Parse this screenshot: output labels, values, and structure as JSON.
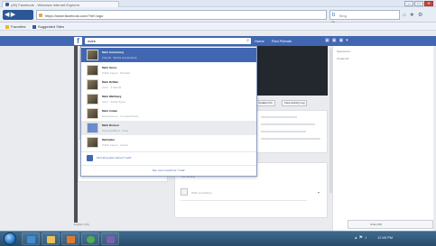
{
  "browser": {
    "tab_title": "(45) Facebook - Windows Internet Explorer",
    "url": "https://www.facebook.com/?ref=logo",
    "search_placeholder": "Bing",
    "window_controls": [
      "–",
      "□",
      "✕"
    ],
    "favorites": {
      "favorites_label": "Favorites",
      "suggested_label": "Suggested Sites"
    }
  },
  "facebook": {
    "search_value": "mark",
    "nav": [
      "Home",
      "Find Friends"
    ],
    "cover_buttons": [
      "Update Info",
      "View Activity Log"
    ],
    "dropdown": {
      "suggestions": [
        {
          "name": "Mark Zuckerberg",
          "meta": "Friends · Works at Facebook"
        },
        {
          "name": "Mark Henry",
          "meta": "Public Figure · Wrestler"
        },
        {
          "name": "Mark Ruffalo",
          "meta": "Actor · 2 friends"
        },
        {
          "name": "Mark Wahlberg",
          "meta": "Actor · Public figure"
        },
        {
          "name": "Mark Cuban",
          "meta": "Entrepreneur · 1 mutual friend"
        },
        {
          "name": "Mark Ronson",
          "meta": "Musician/Band · Page"
        },
        {
          "name": "Markiplier",
          "meta": "Public Figure · Gamer"
        }
      ],
      "find_label": "Find all people named \"mark\"",
      "more_label": "See more results for \"mark\""
    },
    "status": {
      "title": "Update Status",
      "subtitle": "What's on your mind?",
      "privacy": "Public",
      "cancel": "Cancel",
      "post": "Post"
    },
    "post": {
      "title": "Recent Activity",
      "subtitle": "Your activity",
      "input_placeholder": "Write something..."
    },
    "right_panel": [
      "Sponsored",
      "Create Ad"
    ],
    "chat_label": "Chat (Off)",
    "bottom_left": "English (US)"
  },
  "taskbar": {
    "time": "12:45 PM"
  },
  "colors": {
    "facebook_blue": "#4267b2",
    "taskbar": "#274b6b"
  }
}
